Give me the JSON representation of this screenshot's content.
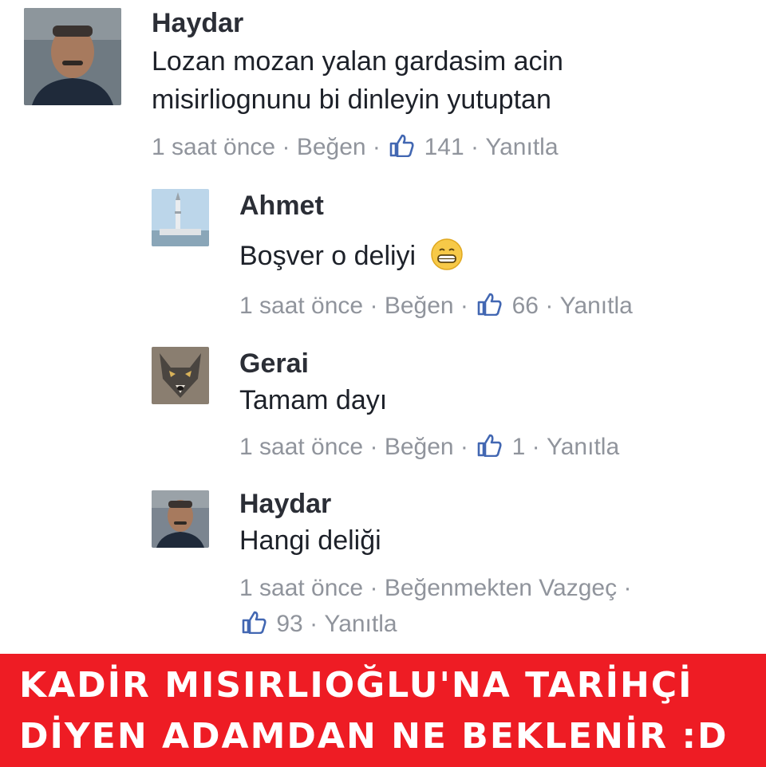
{
  "thread": {
    "comments": [
      {
        "author": "Haydar",
        "text_lines": [
          "Lozan mozan yalan gardasim acin",
          "misirliognunu bi dinleyin yutuptan"
        ],
        "time": "1 saat önce",
        "like_label": "Beğen",
        "likes": "141",
        "reply_label": "Yanıtla"
      },
      {
        "author": "Ahmet",
        "text": "Boşver o deliyi",
        "emoji": "grinning-face-emoji",
        "time": "1 saat önce",
        "like_label": "Beğen",
        "likes": "66",
        "reply_label": "Yanıtla"
      },
      {
        "author": "Gerai",
        "text": "Tamam dayı",
        "time": "1 saat önce",
        "like_label": "Beğen",
        "likes": "1",
        "reply_label": "Yanıtla"
      },
      {
        "author": "Haydar",
        "text": "Hangi deliği",
        "time": "1 saat önce",
        "like_label": "Beğenmekten Vazgeç",
        "likes": "93",
        "reply_label": "Yanıtla"
      }
    ],
    "separator": "·",
    "like_icon": "thumbs-up-icon",
    "colors": {
      "meta": "#90949c",
      "name": "#2b2e36",
      "like_blue": "#4267b2"
    }
  },
  "banner": {
    "line1": "KADİR MISIRLIOĞLU'NA TARİHÇİ",
    "line2": "DİYEN ADAMDAN NE BEKLENİR :D",
    "background": "#ee1c24",
    "text_color": "#ffffff"
  }
}
